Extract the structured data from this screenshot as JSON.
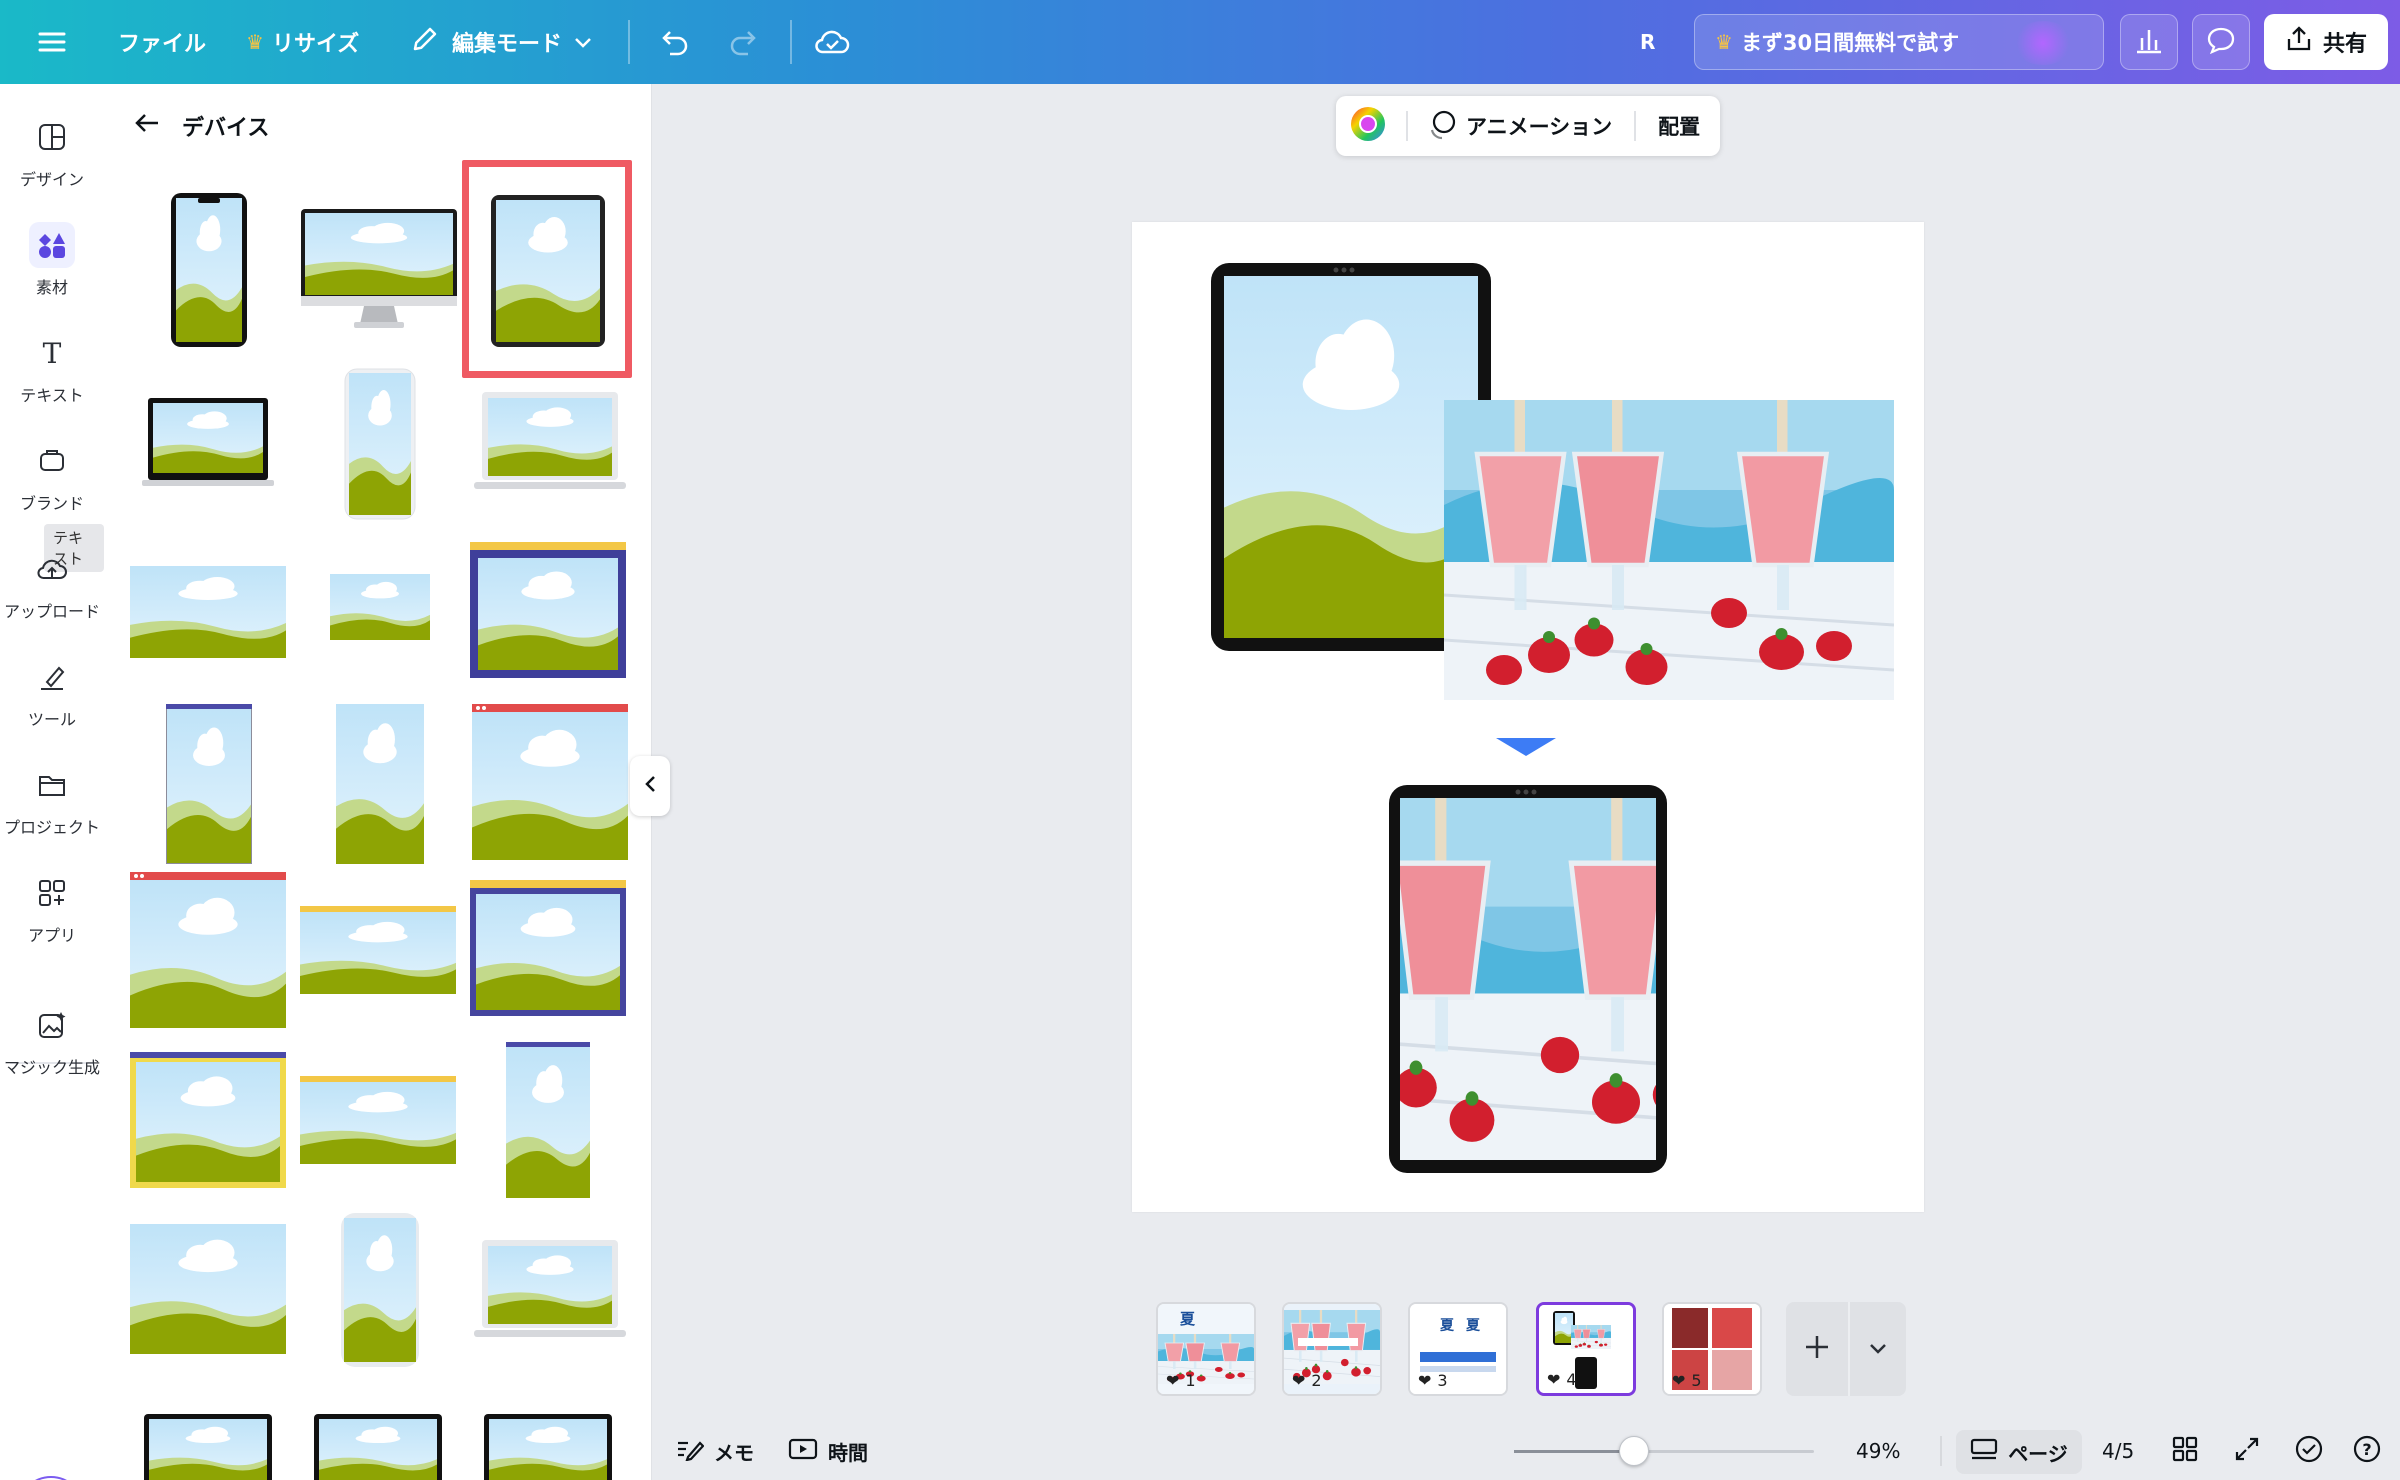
{
  "topbar": {
    "file_label": "ファイル",
    "resize_label": "リサイズ",
    "edit_mode_label": "編集モード",
    "user_initial": "R",
    "trial_label": "まず30日間無料で試す",
    "share_label": "共有"
  },
  "rail": {
    "items": [
      {
        "label": "デザイン",
        "icon": "layout-icon"
      },
      {
        "label": "素材",
        "icon": "elements-icon"
      },
      {
        "label": "テキスト",
        "icon": "text-icon"
      },
      {
        "label": "ブランド",
        "icon": "brand-icon"
      },
      {
        "label": "アップロード",
        "icon": "upload-cloud-icon"
      },
      {
        "label": "ツール",
        "icon": "draw-tool-icon"
      },
      {
        "label": "プロジェクト",
        "icon": "folder-icon"
      },
      {
        "label": "アプリ",
        "icon": "apps-icon"
      },
      {
        "label": "マジック生成",
        "icon": "magic-image-icon"
      }
    ],
    "tooltip": "テキスト"
  },
  "panel": {
    "title": "デバイス"
  },
  "canvas": {
    "animation_label": "アニメーション",
    "arrange_label": "配置"
  },
  "pages": {
    "thumbs": [
      "1",
      "2",
      "3",
      "4",
      "5"
    ],
    "active": 4,
    "thumb_texts": {
      "t1": "夏",
      "t3a": "夏",
      "t3b": "夏"
    }
  },
  "status": {
    "notes_label": "メモ",
    "timer_label": "時間",
    "zoom": "49%",
    "page_view_label": "ページ",
    "page_count": "4/5",
    "zoom_fraction": 0.4
  },
  "colors": {
    "accent": "#7d3bde",
    "selection": "#ef5a63",
    "sky": "#d6eefc",
    "grass": "#8ea404"
  }
}
